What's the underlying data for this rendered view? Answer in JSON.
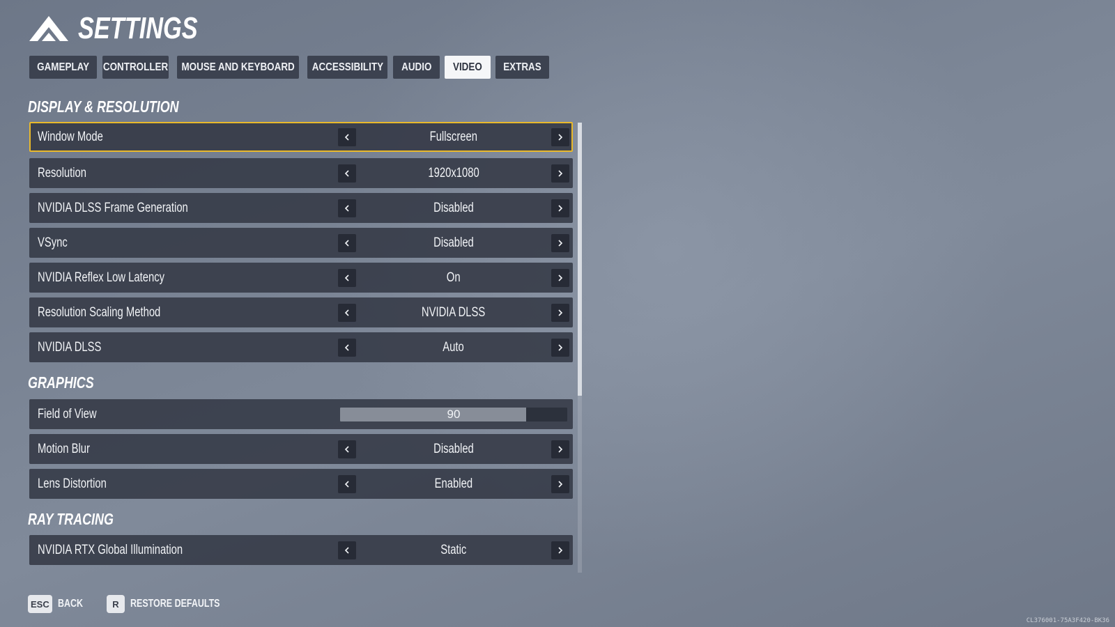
{
  "header": {
    "title": "SETTINGS"
  },
  "tabs": [
    {
      "label": "GAMEPLAY",
      "active": false
    },
    {
      "label": "CONTROLLER",
      "active": false
    },
    {
      "label": "MOUSE AND KEYBOARD",
      "active": false
    },
    {
      "label": "ACCESSIBILITY",
      "active": false
    },
    {
      "label": "AUDIO",
      "active": false
    },
    {
      "label": "VIDEO",
      "active": true
    },
    {
      "label": "EXTRAS",
      "active": false
    }
  ],
  "sections": {
    "display": {
      "title": "DISPLAY & RESOLUTION",
      "rows": [
        {
          "label": "Window Mode",
          "value": "Fullscreen",
          "focused": true
        },
        {
          "label": "Resolution",
          "value": "1920x1080"
        },
        {
          "label": "NVIDIA DLSS Frame Generation",
          "value": "Disabled"
        },
        {
          "label": "VSync",
          "value": "Disabled"
        },
        {
          "label": "NVIDIA Reflex Low Latency",
          "value": "On"
        },
        {
          "label": "Resolution Scaling Method",
          "value": "NVIDIA DLSS"
        },
        {
          "label": "NVIDIA DLSS",
          "value": "Auto"
        }
      ]
    },
    "graphics": {
      "title": "GRAPHICS",
      "fov": {
        "label": "Field of View",
        "value": "90",
        "fill_fraction": 0.82
      },
      "rows": [
        {
          "label": "Motion Blur",
          "value": "Disabled"
        },
        {
          "label": "Lens Distortion",
          "value": "Enabled"
        }
      ]
    },
    "raytracing": {
      "title": "RAY TRACING",
      "rows": [
        {
          "label": "NVIDIA RTX Global Illumination",
          "value": "Static"
        }
      ]
    }
  },
  "footer": {
    "back": {
      "key": "ESC",
      "label": "BACK"
    },
    "restore": {
      "key": "R",
      "label": "RESTORE DEFAULTS"
    }
  },
  "build_id": "CL376001-75A3F420-BK36",
  "colors": {
    "focus": "#e9b92b",
    "tab_active": "#f5f6f8",
    "row_bg": "#343946"
  }
}
